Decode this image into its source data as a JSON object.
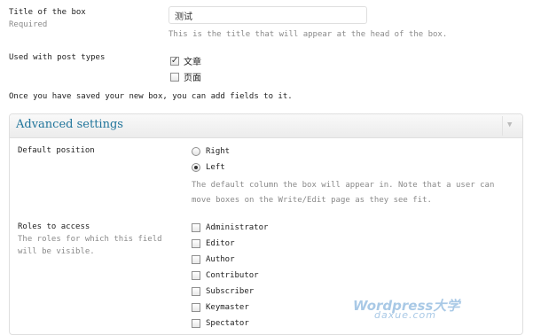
{
  "form": {
    "box_title": {
      "label": "Title of the box",
      "required": "Required",
      "value": "测试",
      "help": "This is the title that will appear at the head of the box."
    },
    "post_types": {
      "label": "Used with post types",
      "options": [
        {
          "label": "文章",
          "checked": true
        },
        {
          "label": "页面",
          "checked": false
        }
      ]
    },
    "note": "Once you have saved your new box, you can add fields to it."
  },
  "advanced": {
    "title": "Advanced settings",
    "toggle_icon": "▼",
    "default_position": {
      "label": "Default position",
      "options": [
        {
          "label": "Right",
          "selected": false
        },
        {
          "label": "Left",
          "selected": true
        }
      ],
      "help_line1": "The default column the box will appear in. Note that a user can",
      "help_line2": "move boxes on the Write/Edit page as they see fit."
    },
    "roles": {
      "label": "Roles to access",
      "help_line1": "The roles for which this field",
      "help_line2": "will be visible.",
      "options": [
        {
          "label": "Administrator",
          "checked": false
        },
        {
          "label": "Editor",
          "checked": false
        },
        {
          "label": "Author",
          "checked": false
        },
        {
          "label": "Contributor",
          "checked": false
        },
        {
          "label": "Subscriber",
          "checked": false
        },
        {
          "label": "Keymaster",
          "checked": false
        },
        {
          "label": "Spectator",
          "checked": false
        }
      ]
    }
  },
  "watermark": {
    "line1": "Wordpress大学",
    "line2": "daxue.com"
  },
  "colors": {
    "accent": "#21759b",
    "muted": "#8a8a8a"
  }
}
